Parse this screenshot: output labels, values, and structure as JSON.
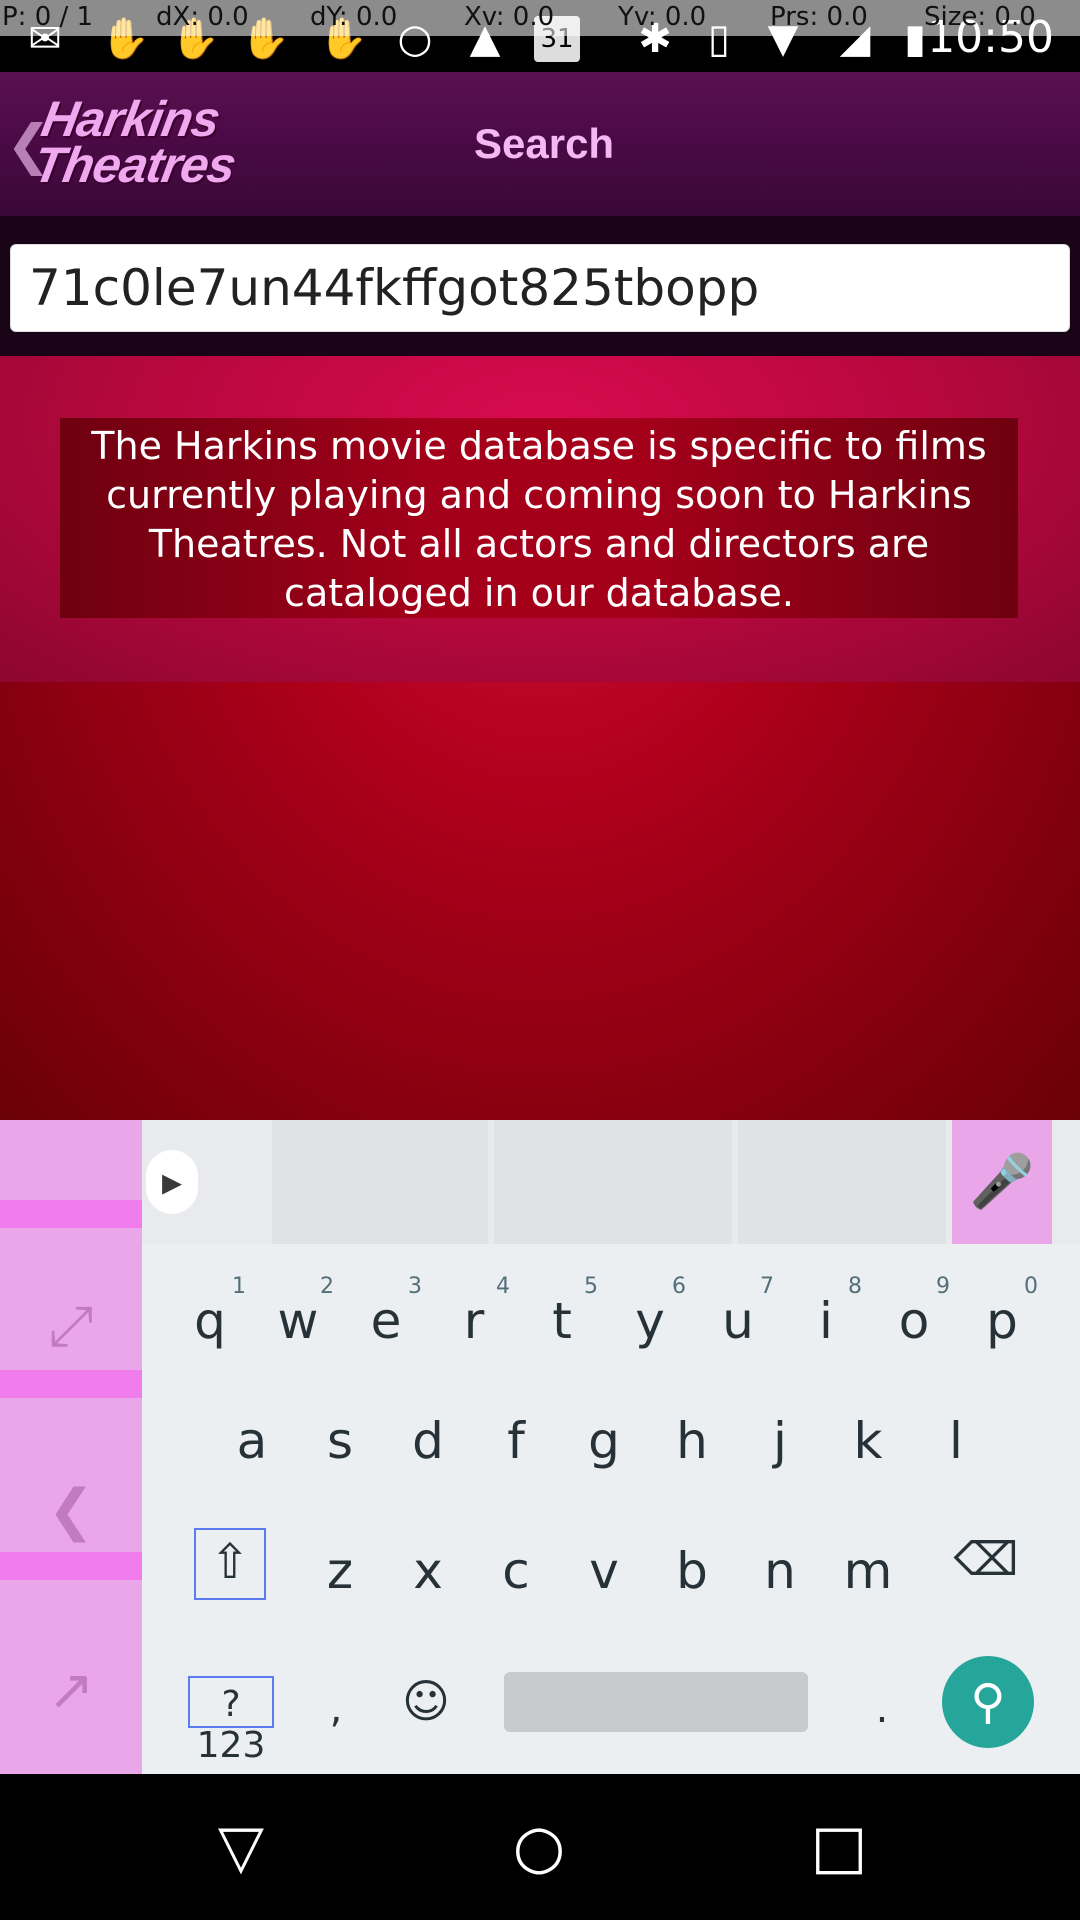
{
  "debug_overlay": {
    "pointer": "P: 0 / 1",
    "dx": "dX: 0.0",
    "dy": "dY: 0.0",
    "xv": "Xv: 0.0",
    "yv": "Yv: 0.0",
    "prs": "Prs: 0.0",
    "size": "Size: 0.0"
  },
  "status_bar": {
    "time": "10:50",
    "calendar_day": "31",
    "icons": [
      "chat-icon",
      "hand-icon",
      "hand-icon",
      "hand-icon",
      "hand-icon",
      "bulb-icon",
      "flask-icon",
      "calendar-icon",
      "bluetooth-icon",
      "vibrate-icon",
      "wifi-icon",
      "signal-icon",
      "battery-icon"
    ]
  },
  "header": {
    "logo_line1": "Harkins",
    "logo_line2": "Theatres",
    "search_label": "Search"
  },
  "search": {
    "value": "71c0le7un44fkffgot825tbopp"
  },
  "notice": {
    "text": "The Harkins movie database is specific to films currently playing and coming soon to Harkins Theatres. Not all actors and directors are cataloged in our database."
  },
  "keyboard": {
    "row1": [
      {
        "key": "q",
        "hint": "1"
      },
      {
        "key": "w",
        "hint": "2"
      },
      {
        "key": "e",
        "hint": "3"
      },
      {
        "key": "r",
        "hint": "4"
      },
      {
        "key": "t",
        "hint": "5"
      },
      {
        "key": "y",
        "hint": "6"
      },
      {
        "key": "u",
        "hint": "7"
      },
      {
        "key": "i",
        "hint": "8"
      },
      {
        "key": "o",
        "hint": "9"
      },
      {
        "key": "p",
        "hint": "0"
      }
    ],
    "row2": [
      "a",
      "s",
      "d",
      "f",
      "g",
      "h",
      "j",
      "k",
      "l"
    ],
    "row3": [
      "z",
      "x",
      "c",
      "v",
      "b",
      "n",
      "m"
    ],
    "symbols_label": "?123",
    "comma_label": ",",
    "period_label": ".",
    "emoji_icon": "emoji-icon",
    "shift_icon": "shift-icon",
    "backspace_icon": "backspace-icon",
    "search_icon": "search-icon",
    "mic_icon": "mic-icon",
    "expand_icon": "chevron-right-icon"
  },
  "keyboard_side": {
    "icons": [
      "fullscreen-icon",
      "chevron-left-icon",
      "popout-icon"
    ]
  },
  "nav_bar": {
    "icons": [
      "back-triangle-icon",
      "home-circle-icon",
      "recents-square-icon"
    ]
  },
  "colors": {
    "header_bg": "#4a0a45",
    "logo_pink": "#f0a8ee",
    "content_red": "#b0001c",
    "keyboard_bg": "#eceff1",
    "accent_teal": "#26a69a"
  }
}
